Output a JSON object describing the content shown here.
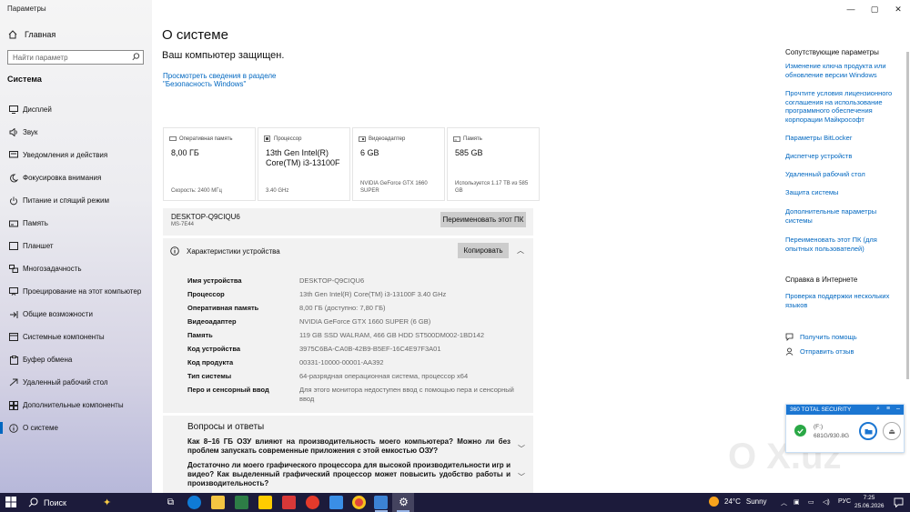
{
  "window": {
    "app_title": "Параметры",
    "controls": {
      "minimize": "—",
      "maximize": "▢",
      "close": "✕"
    }
  },
  "sidebar": {
    "home": "Главная",
    "search_placeholder": "Найти параметр",
    "section": "Система",
    "items": [
      {
        "label": "Дисплей",
        "icon": "display-icon"
      },
      {
        "label": "Звук",
        "icon": "speaker-icon"
      },
      {
        "label": "Уведомления и действия",
        "icon": "notification-icon"
      },
      {
        "label": "Фокусировка внимания",
        "icon": "moon-icon"
      },
      {
        "label": "Питание и спящий режим",
        "icon": "power-icon"
      },
      {
        "label": "Память",
        "icon": "storage-icon"
      },
      {
        "label": "Планшет",
        "icon": "tablet-icon"
      },
      {
        "label": "Многозадачность",
        "icon": "multitask-icon"
      },
      {
        "label": "Проецирование на этот компьютер",
        "icon": "project-icon"
      },
      {
        "label": "Общие возможности",
        "icon": "shared-icon"
      },
      {
        "label": "Системные компоненты",
        "icon": "components-icon"
      },
      {
        "label": "Буфер обмена",
        "icon": "clipboard-icon"
      },
      {
        "label": "Удаленный рабочий стол",
        "icon": "remote-icon"
      },
      {
        "label": "Дополнительные компоненты",
        "icon": "addons-icon"
      },
      {
        "label": "О системе",
        "icon": "info-icon",
        "active": true
      }
    ]
  },
  "main": {
    "title": "О системе",
    "protected": "Ваш компьютер защищен.",
    "security_link": "Просмотреть сведения в разделе \"Безопасность Windows\"",
    "cards": [
      {
        "head": "Оперативная память",
        "value": "8,00 ГБ",
        "foot": "Скорость: 2400 МГц"
      },
      {
        "head": "Процессор",
        "value": "13th Gen Intel(R) Core(TM) i3-13100F",
        "foot": "3.40 GHz"
      },
      {
        "head": "Видеоадаптер",
        "value": "6 GB",
        "foot": "NVIDIA GeForce GTX 1660 SUPER"
      },
      {
        "head": "Память",
        "value": "585 GB",
        "foot": "Используется 1.17 TB из 585 GB"
      }
    ],
    "pc": {
      "name": "DESKTOP-Q9CIQU6",
      "model": "MS-7E44",
      "rename_button": "Переименовать этот ПК"
    },
    "device": {
      "title": "Характеристики устройства",
      "copy_button": "Копировать",
      "specs": [
        {
          "label": "Имя устройства",
          "value": "DESKTOP-Q9CIQU6"
        },
        {
          "label": "Процессор",
          "value": "13th Gen Intel(R) Core(TM) i3-13100F   3.40 GHz"
        },
        {
          "label": "Оперативная память",
          "value": "8,00 ГБ (доступно: 7,80 ГБ)"
        },
        {
          "label": "Видеоадаптер",
          "value": "NVIDIA GeForce GTX 1660 SUPER (6 GB)"
        },
        {
          "label": "Память",
          "value": "119 GB SSD WALRAM, 466 GB HDD ST500DM002-1BD142"
        },
        {
          "label": "Код устройства",
          "value": "3975C6BA-CA0B-42B9-B5EF-16C4E97F3A01"
        },
        {
          "label": "Код продукта",
          "value": "00331-10000-00001-AA392"
        },
        {
          "label": "Тип системы",
          "value": "64-разрядная операционная система, процессор x64"
        },
        {
          "label": "Перо и сенсорный ввод",
          "value": "Для этого монитора недоступен ввод с помощью пера и сенсорный ввод"
        }
      ]
    },
    "faq": {
      "title": "Вопросы и ответы",
      "questions": [
        "Как 8–16 ГБ ОЗУ влияют на производительность моего компьютера? Можно ли без проблем запускать современные приложения с этой емкостью ОЗУ?",
        "Достаточно ли моего графического процессора для высокой производительности игр и видео? Как выделенный графический процессор может повысить удобство работы и производительность?"
      ]
    }
  },
  "related": {
    "title": "Сопутствующие параметры",
    "links": [
      "Изменение ключа продукта или обновление версии Windows",
      "Прочтите условия лицензионного соглашения на использование программного обеспечения корпорации Майкрософт",
      "Параметры BitLocker",
      "Диспетчер устройств",
      "Удаленный рабочий стол",
      "Защита системы",
      "Дополнительные параметры системы",
      "Переименовать этот ПК (для опытных пользователей)"
    ],
    "web_title": "Справка в Интернете",
    "web_links": [
      "Проверка поддержки нескольких языков"
    ],
    "help": "Получить помощь",
    "feedback": "Отправить отзыв"
  },
  "widget360": {
    "title": "360 TOTAL SECURITY",
    "drive": "(F:)",
    "size": "681G/930.8G"
  },
  "taskbar": {
    "search": "Поиск",
    "weather_temp": "24°C",
    "weather_text": "Sunny",
    "lang": "РУС",
    "time": "7:25",
    "date": "25.06.2026"
  },
  "colors": {
    "accent": "#0067c0",
    "taskbar": "#1c1b3b",
    "panel": "#f2f2f2"
  }
}
